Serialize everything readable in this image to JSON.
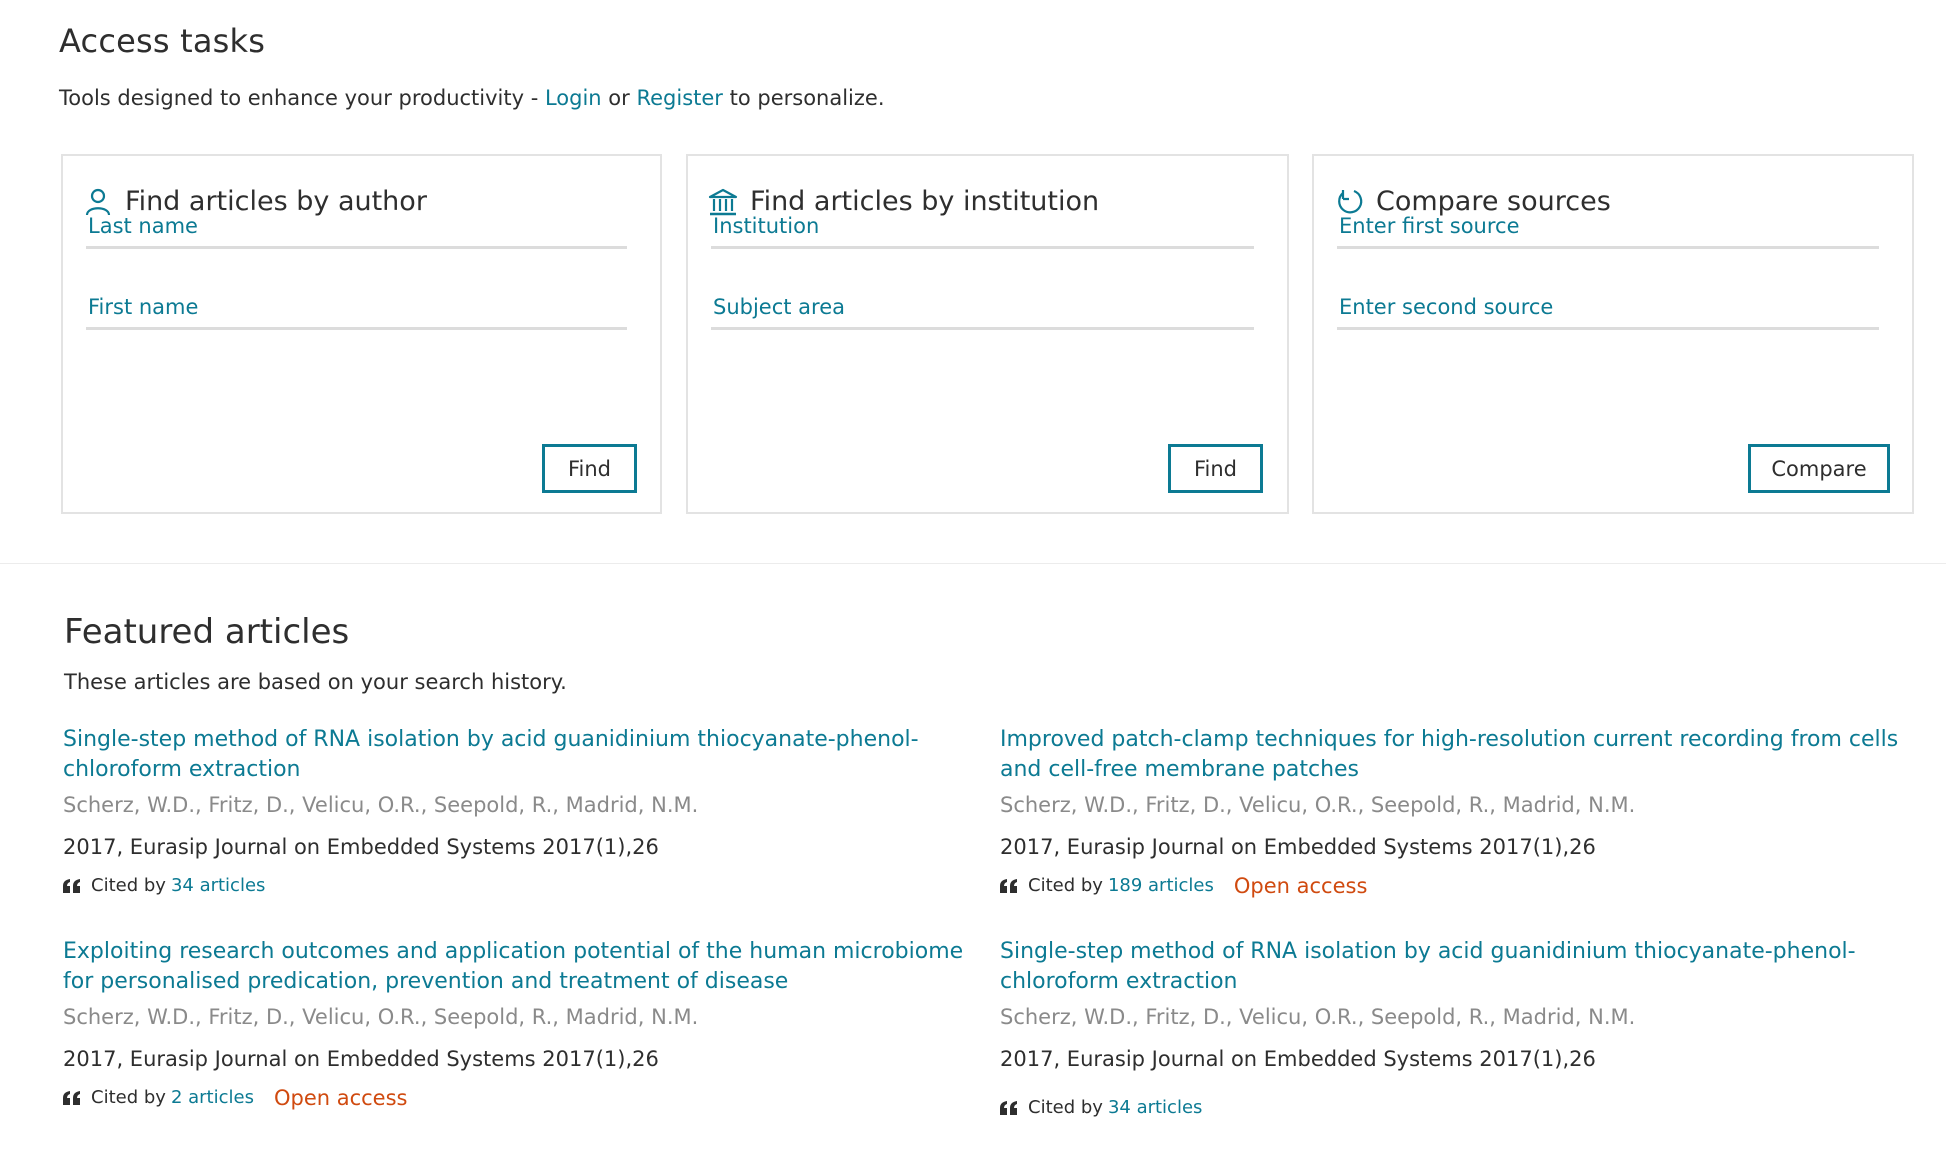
{
  "access": {
    "title": "Access tasks",
    "intro_prefix": "Tools designed to enhance your productivity - ",
    "login": "Login",
    "or": " or ",
    "register": "Register",
    "intro_suffix": " to personalize.",
    "cards": [
      {
        "title": "Find articles by author",
        "icon": "person-icon",
        "field1": "Last name",
        "field2": "First name",
        "button": "Find"
      },
      {
        "title": "Find articles by institution",
        "icon": "institution-icon",
        "field1": "Institution",
        "field2": "Subject area",
        "button": "Find"
      },
      {
        "title": "Compare sources",
        "icon": "compare-icon",
        "field1": "Enter first source",
        "field2": "Enter second source",
        "button": "Compare"
      }
    ]
  },
  "featured": {
    "title": "Featured articles",
    "subtitle": "These articles are based on your search history.",
    "cited_by_label": "Cited by",
    "open_access_label": "Open access",
    "articles": [
      {
        "title": "Single-step method of RNA isolation by acid guanidinium thiocyanate-phenol-chloroform extraction",
        "authors": "Scherz, W.D., Fritz, D., Velicu, O.R., Seepold, R., Madrid, N.M.",
        "source": "2017, Eurasip Journal on Embedded Systems 2017(1),26",
        "cited": "34 articles",
        "open_access": false
      },
      {
        "title": "Improved patch-clamp techniques for high-resolution current recording from cells and cell-free membrane patches",
        "authors": "Scherz, W.D., Fritz, D., Velicu, O.R., Seepold, R., Madrid, N.M.",
        "source": "2017, Eurasip Journal on Embedded Systems 2017(1),26",
        "cited": "189 articles",
        "open_access": true
      },
      {
        "title": "Exploiting research outcomes and application potential of the human microbiome for personalised predication, prevention and treatment of disease",
        "authors": "Scherz, W.D., Fritz, D., Velicu, O.R., Seepold, R., Madrid, N.M.",
        "source": "2017, Eurasip Journal on Embedded Systems 2017(1),26",
        "cited": "2 articles",
        "open_access": true
      },
      {
        "title": "Single-step method of RNA isolation by acid guanidinium thiocyanate-phenol-chloroform extraction",
        "authors": "Scherz, W.D., Fritz, D., Velicu, O.R., Seepold, R., Madrid, N.M.",
        "source": "2017, Eurasip Journal on Embedded Systems 2017(1),26",
        "cited": "34 articles",
        "open_access": false
      }
    ]
  },
  "colors": {
    "link": "#0c7a93",
    "open_access": "#d04a0f",
    "border": "#e3e3e3"
  }
}
